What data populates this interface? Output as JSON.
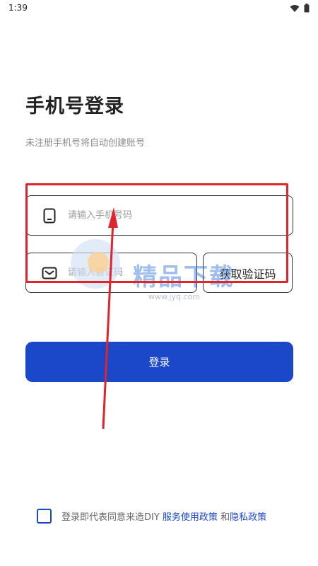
{
  "status_bar": {
    "time": "1:39",
    "icons": [
      "wifi-icon",
      "battery-icon"
    ]
  },
  "header": {
    "title": "手机号登录",
    "subtitle": "未注册手机号将自动创建账号"
  },
  "form": {
    "phone": {
      "placeholder": "请输入手机号码",
      "icon": "phone-icon"
    },
    "code": {
      "placeholder": "请输入验证码",
      "icon": "mail-icon"
    },
    "get_code_label": "获取验证码",
    "login_label": "登录"
  },
  "agreement": {
    "prefix": "登录即代表同意来造DIY ",
    "service_policy": "服务使用政策",
    "joiner": " 和",
    "privacy_policy": "隐私政策"
  },
  "watermark": {
    "text": "精品下载",
    "url": "www.jyq.com"
  },
  "colors": {
    "primary": "#1b47c9",
    "annotation": "#e0242b",
    "text": "#222222",
    "muted": "#8a8a8a"
  }
}
